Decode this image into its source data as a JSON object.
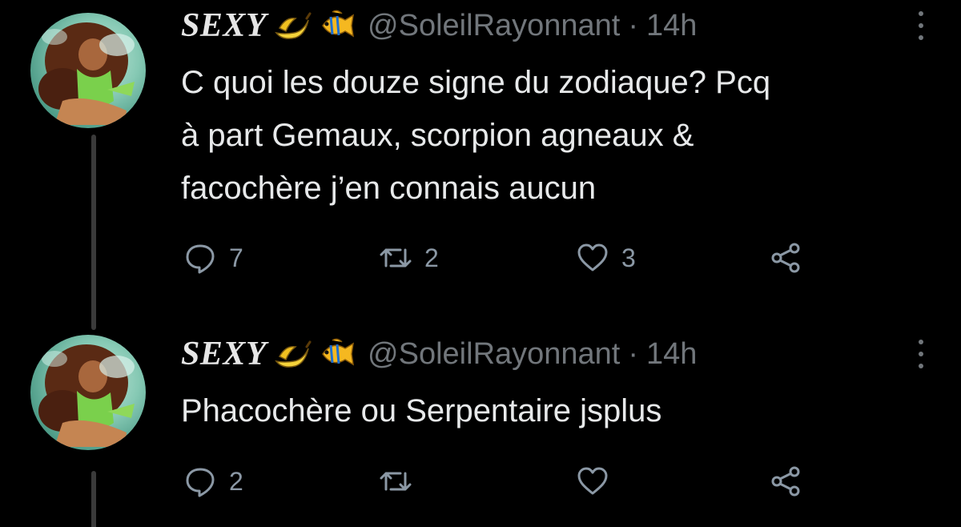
{
  "colors": {
    "background": "#000000",
    "text": "#e7e9ea",
    "muted": "#71767b",
    "thread_line": "#3a3a3a"
  },
  "tweets": [
    {
      "display_name": "SEXY",
      "name_emojis": [
        "banana-icon",
        "tropical-fish-icon"
      ],
      "handle": "@SoleilRayonnant",
      "separator": "·",
      "time": "14h",
      "text_lines": [
        "C quoi les douze signe du zodiaque? Pcq",
        "à part Gemaux, scorpion agneaux &",
        "facochère j’en connais aucun"
      ],
      "replies": "7",
      "retweets": "2",
      "likes": "3"
    },
    {
      "display_name": "SEXY",
      "name_emojis": [
        "banana-icon",
        "tropical-fish-icon"
      ],
      "handle": "@SoleilRayonnant",
      "separator": "·",
      "time": "14h",
      "text_lines": [
        "Phacochère ou Serpentaire jsplus"
      ],
      "replies": "2",
      "retweets": "",
      "likes": ""
    }
  ]
}
